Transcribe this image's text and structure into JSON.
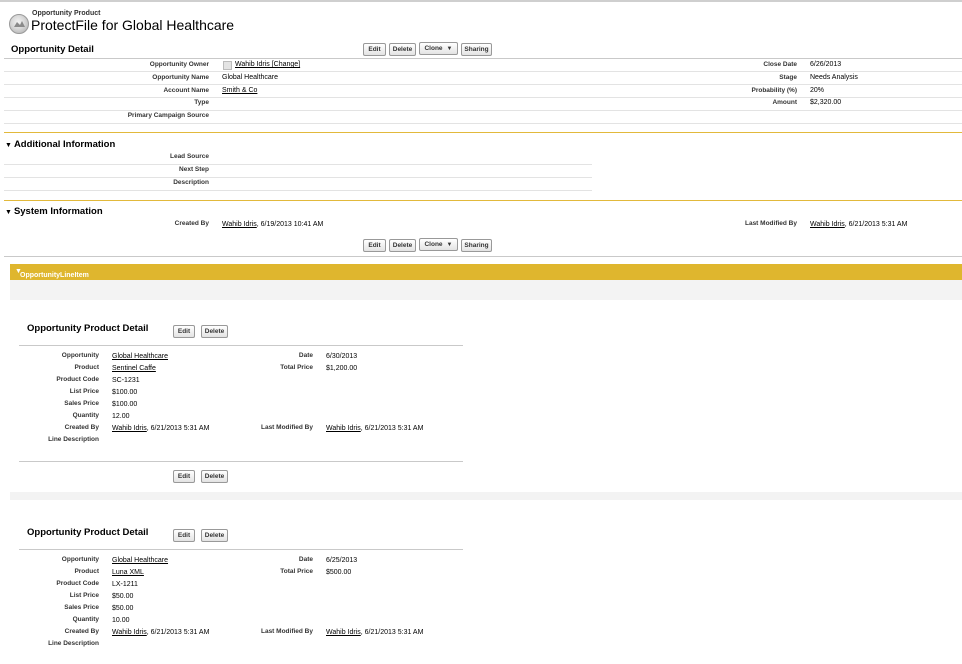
{
  "header": {
    "subtitle": "Opportunity Product",
    "title": "ProtectFile for Global Healthcare"
  },
  "buttons": {
    "edit": "Edit",
    "delete": "Delete",
    "clone": "Clone",
    "sharing": "Sharing"
  },
  "opportunity_detail": {
    "title": "Opportunity Detail",
    "left": [
      {
        "label": "Opportunity Owner",
        "value": "Wahib Idris [Change]",
        "link": true
      },
      {
        "label": "Opportunity Name",
        "value": "Global Healthcare",
        "link": false
      },
      {
        "label": "Account Name",
        "value": "Smith & Co",
        "link": true
      },
      {
        "label": "Type",
        "value": "",
        "link": false
      },
      {
        "label": "Primary Campaign Source",
        "value": "",
        "link": false
      }
    ],
    "right": [
      {
        "label": "Close Date",
        "value": "6/26/2013"
      },
      {
        "label": "Stage",
        "value": "Needs Analysis"
      },
      {
        "label": "Probability (%)",
        "value": "20%"
      },
      {
        "label": "Amount",
        "value": "$2,320.00"
      }
    ]
  },
  "additional_info": {
    "title": "Additional Information",
    "rows": [
      {
        "label": "Lead Source",
        "value": ""
      },
      {
        "label": "Next Step",
        "value": ""
      },
      {
        "label": "Description",
        "value": ""
      }
    ]
  },
  "system_info": {
    "title": "System Information",
    "created_by_label": "Created By",
    "created_by_user": "Wahib Idris",
    "created_by_date": ", 6/19/2013 10:41 AM",
    "modified_by_label": "Last Modified By",
    "modified_by_user": "Wahib Idris",
    "modified_by_date": ", 6/21/2013 5:31 AM"
  },
  "line_items": {
    "title": "OpportunityLineItem",
    "cards": [
      {
        "title": "Opportunity Product Detail",
        "left": [
          {
            "label": "Opportunity",
            "value": "Global Healthcare",
            "link": true
          },
          {
            "label": "Product",
            "value": "Sentinel Caffe",
            "link": true
          },
          {
            "label": "Product Code",
            "value": "SC-1231",
            "link": false
          },
          {
            "label": "List Price",
            "value": "$100.00",
            "link": false
          },
          {
            "label": "Sales Price",
            "value": "$100.00",
            "link": false
          },
          {
            "label": "Quantity",
            "value": "12.00",
            "link": false
          }
        ],
        "created_by_label": "Created By",
        "created_by_user": "Wahib Idris",
        "created_by_date": ", 6/21/2013 5:31 AM",
        "line_desc_label": "Line Description",
        "right": [
          {
            "label": "Date",
            "value": "6/30/2013"
          },
          {
            "label": "Total Price",
            "value": "$1,200.00"
          }
        ],
        "modified_by_label": "Last Modified By",
        "modified_by_user": "Wahib Idris",
        "modified_by_date": ", 6/21/2013 5:31 AM"
      },
      {
        "title": "Opportunity Product Detail",
        "left": [
          {
            "label": "Opportunity",
            "value": "Global Healthcare",
            "link": true
          },
          {
            "label": "Product",
            "value": "Luna XML",
            "link": true
          },
          {
            "label": "Product Code",
            "value": "LX-1211",
            "link": false
          },
          {
            "label": "List Price",
            "value": "$50.00",
            "link": false
          },
          {
            "label": "Sales Price",
            "value": "$50.00",
            "link": false
          },
          {
            "label": "Quantity",
            "value": "10.00",
            "link": false
          }
        ],
        "created_by_label": "Created By",
        "created_by_user": "Wahib Idris",
        "created_by_date": ", 6/21/2013 5:31 AM",
        "line_desc_label": "Line Description",
        "right": [
          {
            "label": "Date",
            "value": "6/25/2013"
          },
          {
            "label": "Total Price",
            "value": "$500.00"
          }
        ],
        "modified_by_label": "Last Modified By",
        "modified_by_user": "Wahib Idris",
        "modified_by_date": ", 6/21/2013 5:31 AM"
      }
    ]
  },
  "colors": {
    "section_bar": "#dfb62e",
    "section_rule": "#e2b93b"
  }
}
